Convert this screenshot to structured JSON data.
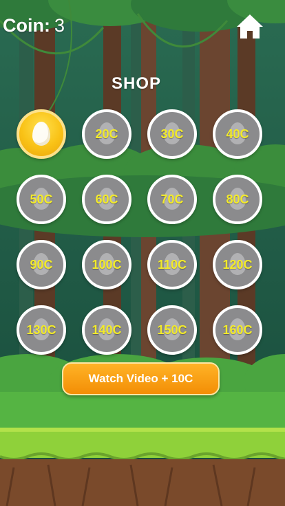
{
  "hud": {
    "coin_label": "Coin:",
    "coin_value": "3",
    "home_icon": "home-icon"
  },
  "shop": {
    "title": "SHOP",
    "items": [
      {
        "price": "",
        "owned": true
      },
      {
        "price": "20C",
        "owned": false
      },
      {
        "price": "30C",
        "owned": false
      },
      {
        "price": "40C",
        "owned": false
      },
      {
        "price": "50C",
        "owned": false
      },
      {
        "price": "60C",
        "owned": false
      },
      {
        "price": "70C",
        "owned": false
      },
      {
        "price": "80C",
        "owned": false
      },
      {
        "price": "90C",
        "owned": false
      },
      {
        "price": "100C",
        "owned": false
      },
      {
        "price": "110C",
        "owned": false
      },
      {
        "price": "120C",
        "owned": false
      },
      {
        "price": "130C",
        "owned": false
      },
      {
        "price": "140C",
        "owned": false
      },
      {
        "price": "150C",
        "owned": false
      },
      {
        "price": "160C",
        "owned": false
      }
    ]
  },
  "watch_button": {
    "label": "Watch Video + 10C"
  },
  "colors": {
    "price_text": "#f2ea2b",
    "owned_gold": "#f9c216",
    "locked_gray": "#8b8b8d",
    "button_orange": "#f7a010"
  }
}
